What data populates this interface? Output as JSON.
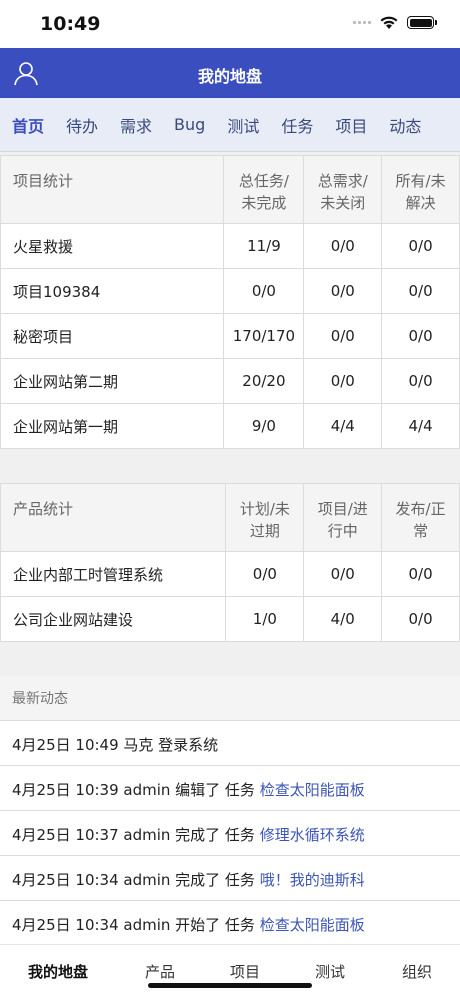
{
  "status": {
    "time": "10:49"
  },
  "header": {
    "title": "我的地盘"
  },
  "tabs": [
    "首页",
    "待办",
    "需求",
    "Bug",
    "测试",
    "任务",
    "项目",
    "动态"
  ],
  "projects": {
    "headers": [
      "项目统计",
      "总任务/\n未完成",
      "总需求/\n未关闭",
      "所有/未\n解决"
    ],
    "rows": [
      [
        "火星救援",
        "11/9",
        "0/0",
        "0/0"
      ],
      [
        "项目109384",
        "0/0",
        "0/0",
        "0/0"
      ],
      [
        "秘密项目",
        "170/170",
        "0/0",
        "0/0"
      ],
      [
        "企业网站第二期",
        "20/20",
        "0/0",
        "0/0"
      ],
      [
        "企业网站第一期",
        "9/0",
        "4/4",
        "4/4"
      ]
    ]
  },
  "products": {
    "headers": [
      "产品统计",
      "计划/未\n过期",
      "项目/进\n行中",
      "发布/正\n常"
    ],
    "rows": [
      [
        "企业内部工时管理系统",
        "0/0",
        "0/0",
        "0/0"
      ],
      [
        "公司企业网站建设",
        "1/0",
        "4/0",
        "0/0"
      ]
    ]
  },
  "feed": {
    "title": "最新动态",
    "items": [
      {
        "text": "4月25日 10:49 马克 登录系统",
        "link": ""
      },
      {
        "text": "4月25日 10:39 admin 编辑了 任务 ",
        "link": "检查太阳能面板"
      },
      {
        "text": "4月25日 10:37 admin 完成了 任务 ",
        "link": "修理水循环系统"
      },
      {
        "text": "4月25日 10:34 admin 完成了 任务 ",
        "link": "哦！我的迪斯科"
      },
      {
        "text": "4月25日 10:34 admin 开始了 任务 ",
        "link": "检查太阳能面板"
      }
    ]
  },
  "tabbar": [
    "我的地盘",
    "产品",
    "项目",
    "测试",
    "组织"
  ],
  "colors": {
    "brand": "#3b4ec0",
    "link": "#3b55b8"
  }
}
